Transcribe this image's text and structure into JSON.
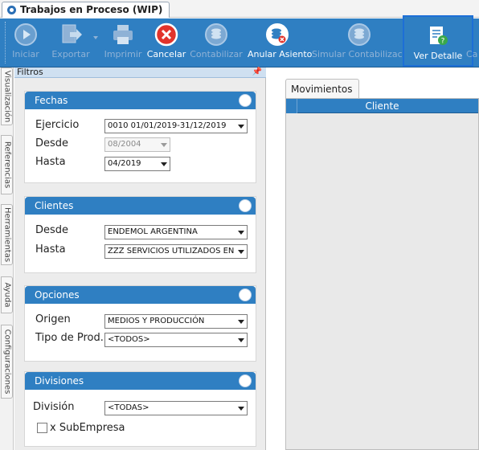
{
  "window": {
    "tab_title": "Trabajos en Proceso (WIP)"
  },
  "toolbar": {
    "buttons": [
      {
        "label": "Iniciar",
        "icon": "play-icon",
        "enabled": false
      },
      {
        "label": "Exportar",
        "icon": "export-icon",
        "enabled": false
      },
      {
        "label": "Imprimir",
        "icon": "printer-icon",
        "enabled": false
      },
      {
        "label": "Cancelar",
        "icon": "cancel-icon",
        "enabled": true
      },
      {
        "label": "Contabilizar",
        "icon": "coins-icon",
        "enabled": false
      },
      {
        "label": "Anular Asiento",
        "icon": "coins-cancel-icon",
        "enabled": true
      },
      {
        "label": "Simular Contabilización",
        "icon": "coins-icon",
        "enabled": false
      },
      {
        "label": "Ver Detalle",
        "icon": "document-help-icon",
        "enabled": true
      },
      {
        "label": "Ca",
        "icon": "truncated-icon",
        "enabled": false
      }
    ]
  },
  "side_tabs": [
    "Visualización",
    "Referencias",
    "Herramientas",
    "Ayuda",
    "Configuraciones"
  ],
  "filters": {
    "title": "Filtros",
    "fechas": {
      "title": "Fechas",
      "ejercicio_label": "Ejercicio",
      "ejercicio_value": "0010 01/01/2019-31/12/2019",
      "desde_label": "Desde",
      "desde_value": "08/2004",
      "hasta_label": "Hasta",
      "hasta_value": "04/2019"
    },
    "clientes": {
      "title": "Clientes",
      "desde_label": "Desde",
      "desde_value": "ENDEMOL ARGENTINA",
      "hasta_label": "Hasta",
      "hasta_value": "ZZZ SERVICIOS UTILIZADOS EN E"
    },
    "opciones": {
      "title": "Opciones",
      "origen_label": "Origen",
      "origen_value": "MEDIOS Y PRODUCCIÓN",
      "tipo_label": "Tipo de Prod.",
      "tipo_value": "<TODOS>"
    },
    "divisiones": {
      "title": "Divisiones",
      "division_label": "División",
      "division_value": "<TODAS>",
      "subempresa_label": "x SubEmpresa",
      "subempresa_checked": false
    }
  },
  "movimientos": {
    "tab_label": "Movimientos",
    "columns": [
      "Cliente"
    ]
  },
  "colors": {
    "accent": "#2f7fc2",
    "highlight_border": "#1d6fd6"
  }
}
